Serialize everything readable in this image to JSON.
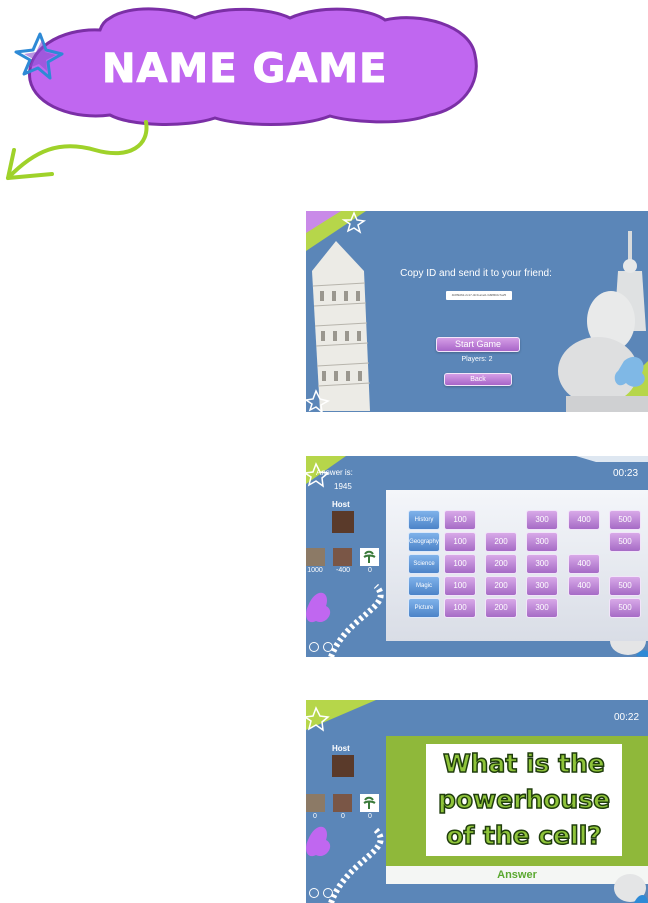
{
  "header": {
    "title": "NAME GAME",
    "bubble_color": "#c067f0",
    "arrow_color": "#9fd22a",
    "star_color": "#2e8ad6"
  },
  "lobby": {
    "prompt": "Copy ID and send it to your friend:",
    "id_value": "4b8f9d62-2c17-4fc9-a1e0-3d9f8b6c7a25",
    "start_label": "Start Game",
    "players_text": "Players: 2",
    "back_label": "Back"
  },
  "board_screen": {
    "answer_label": "Answer is:",
    "answer_value": "1945",
    "timer": "00:23",
    "host_label": "Host",
    "scores": [
      "1000",
      "-400",
      "0"
    ],
    "categories": [
      "History",
      "Geography",
      "Science",
      "Magic",
      "Picture"
    ],
    "rows": [
      [
        "100",
        "",
        "300",
        "400",
        "500"
      ],
      [
        "100",
        "200",
        "300",
        "",
        "500"
      ],
      [
        "100",
        "200",
        "300",
        "400",
        ""
      ],
      [
        "100",
        "200",
        "300",
        "400",
        "500"
      ],
      [
        "100",
        "200",
        "300",
        "",
        "500"
      ]
    ]
  },
  "question_screen": {
    "timer": "00:22",
    "host_label": "Host",
    "scores": [
      "0",
      "0",
      "0"
    ],
    "question": "What is the powerhouse of the cell?",
    "answer_button": "Answer"
  }
}
